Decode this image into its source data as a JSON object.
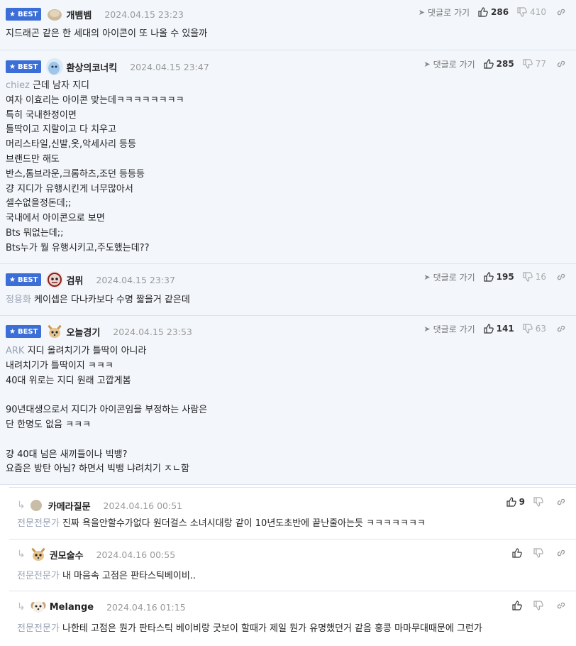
{
  "common": {
    "best_label": "BEST",
    "goto_label": "댓글로 가기"
  },
  "comments": [
    {
      "nick": "개뱀벰",
      "date": "2024.04.15 23:23",
      "likes": "286",
      "dislikes": "410",
      "quote": "",
      "lines": [
        "지드래곤 같은 한 세대의 아이콘이 또 나올 수 있을까"
      ]
    },
    {
      "nick": "환상의코너킥",
      "date": "2024.04.15 23:47",
      "likes": "285",
      "dislikes": "77",
      "quote": "chiez",
      "lines": [
        "근데 남자 지디",
        "여자 이효리는 아이콘 맞는데ㅋㅋㅋㅋㅋㅋㅋㅋ",
        "특히 국내한정이면",
        "틀딱이고 지랄이고 다 치우고",
        "머리스타일,신발,옷,악세사리 등등",
        "브랜드만 해도",
        "반스,톰브라운,크롬하츠,조던 등등등",
        "걍 지디가 유행시킨게 너무많아서",
        "셀수없을정돈데;;",
        "국내에서 아이콘으로 보면",
        "Bts 뭐없는데;;",
        "Bts누가 뭘 유행시키고,주도했는데??"
      ]
    },
    {
      "nick": "검뮈",
      "date": "2024.04.15 23:37",
      "likes": "195",
      "dislikes": "16",
      "quote": "정용화",
      "lines": [
        "케이셉은 다나카보다 수명 짧을거 같은데"
      ]
    },
    {
      "nick": "오늘경기",
      "date": "2024.04.15 23:53",
      "likes": "141",
      "dislikes": "63",
      "quote": "ARK",
      "lines": [
        "지디 올려치기가 틀딱이 아니라",
        "내려치기가 틀딱이지 ㅋㅋㅋ",
        "40대 위로는 지디 원래 고깝게봄",
        "",
        "90년대생으로서 지디가 아이콘임을 부정하는 사람은",
        "단 한명도 없음 ㅋㅋㅋ",
        "",
        "걍 40대 넘은 새끼들이나 빅뱅?",
        "요즘은 방탄 아님? 하면서 빅뱅 냐려치기 ㅈㄴ함"
      ]
    }
  ],
  "replies": [
    {
      "nick": "카메라질문",
      "date": "2024.04.16 00:51",
      "likes": "9",
      "quote": "전문전문가",
      "text": "진짜 욕을안할수가없다 원더걸스 소녀시대랑 같이 10년도초반에 끝난줄아는듯 ㅋㅋㅋㅋㅋㅋㅋ"
    },
    {
      "nick": "권모술수",
      "date": "2024.04.16 00:55",
      "likes": "",
      "quote": "전문전문가",
      "text": "내 마음속 고점은 판타스틱베이비.."
    },
    {
      "nick": "Melange",
      "date": "2024.04.16 01:15",
      "likes": "",
      "quote": "전문전문가",
      "text": "나한테 고점은 뭔가 판타스틱 베이비랑 굿보이 할때가 제일 뭔가 유명했던거 같음 홍콩 마마무대때문에 그런가"
    }
  ],
  "icons": {
    "goto": "send-arrow-icon",
    "like": "thumbs-up-icon",
    "dislike": "thumbs-down-icon",
    "share": "link-icon",
    "reply": "reply-arrow-icon",
    "star": "star-icon"
  },
  "colors": {
    "best_badge": "#3b6ed6",
    "best_background": "#f3f6fb",
    "quote_text": "#9aa3b5"
  }
}
